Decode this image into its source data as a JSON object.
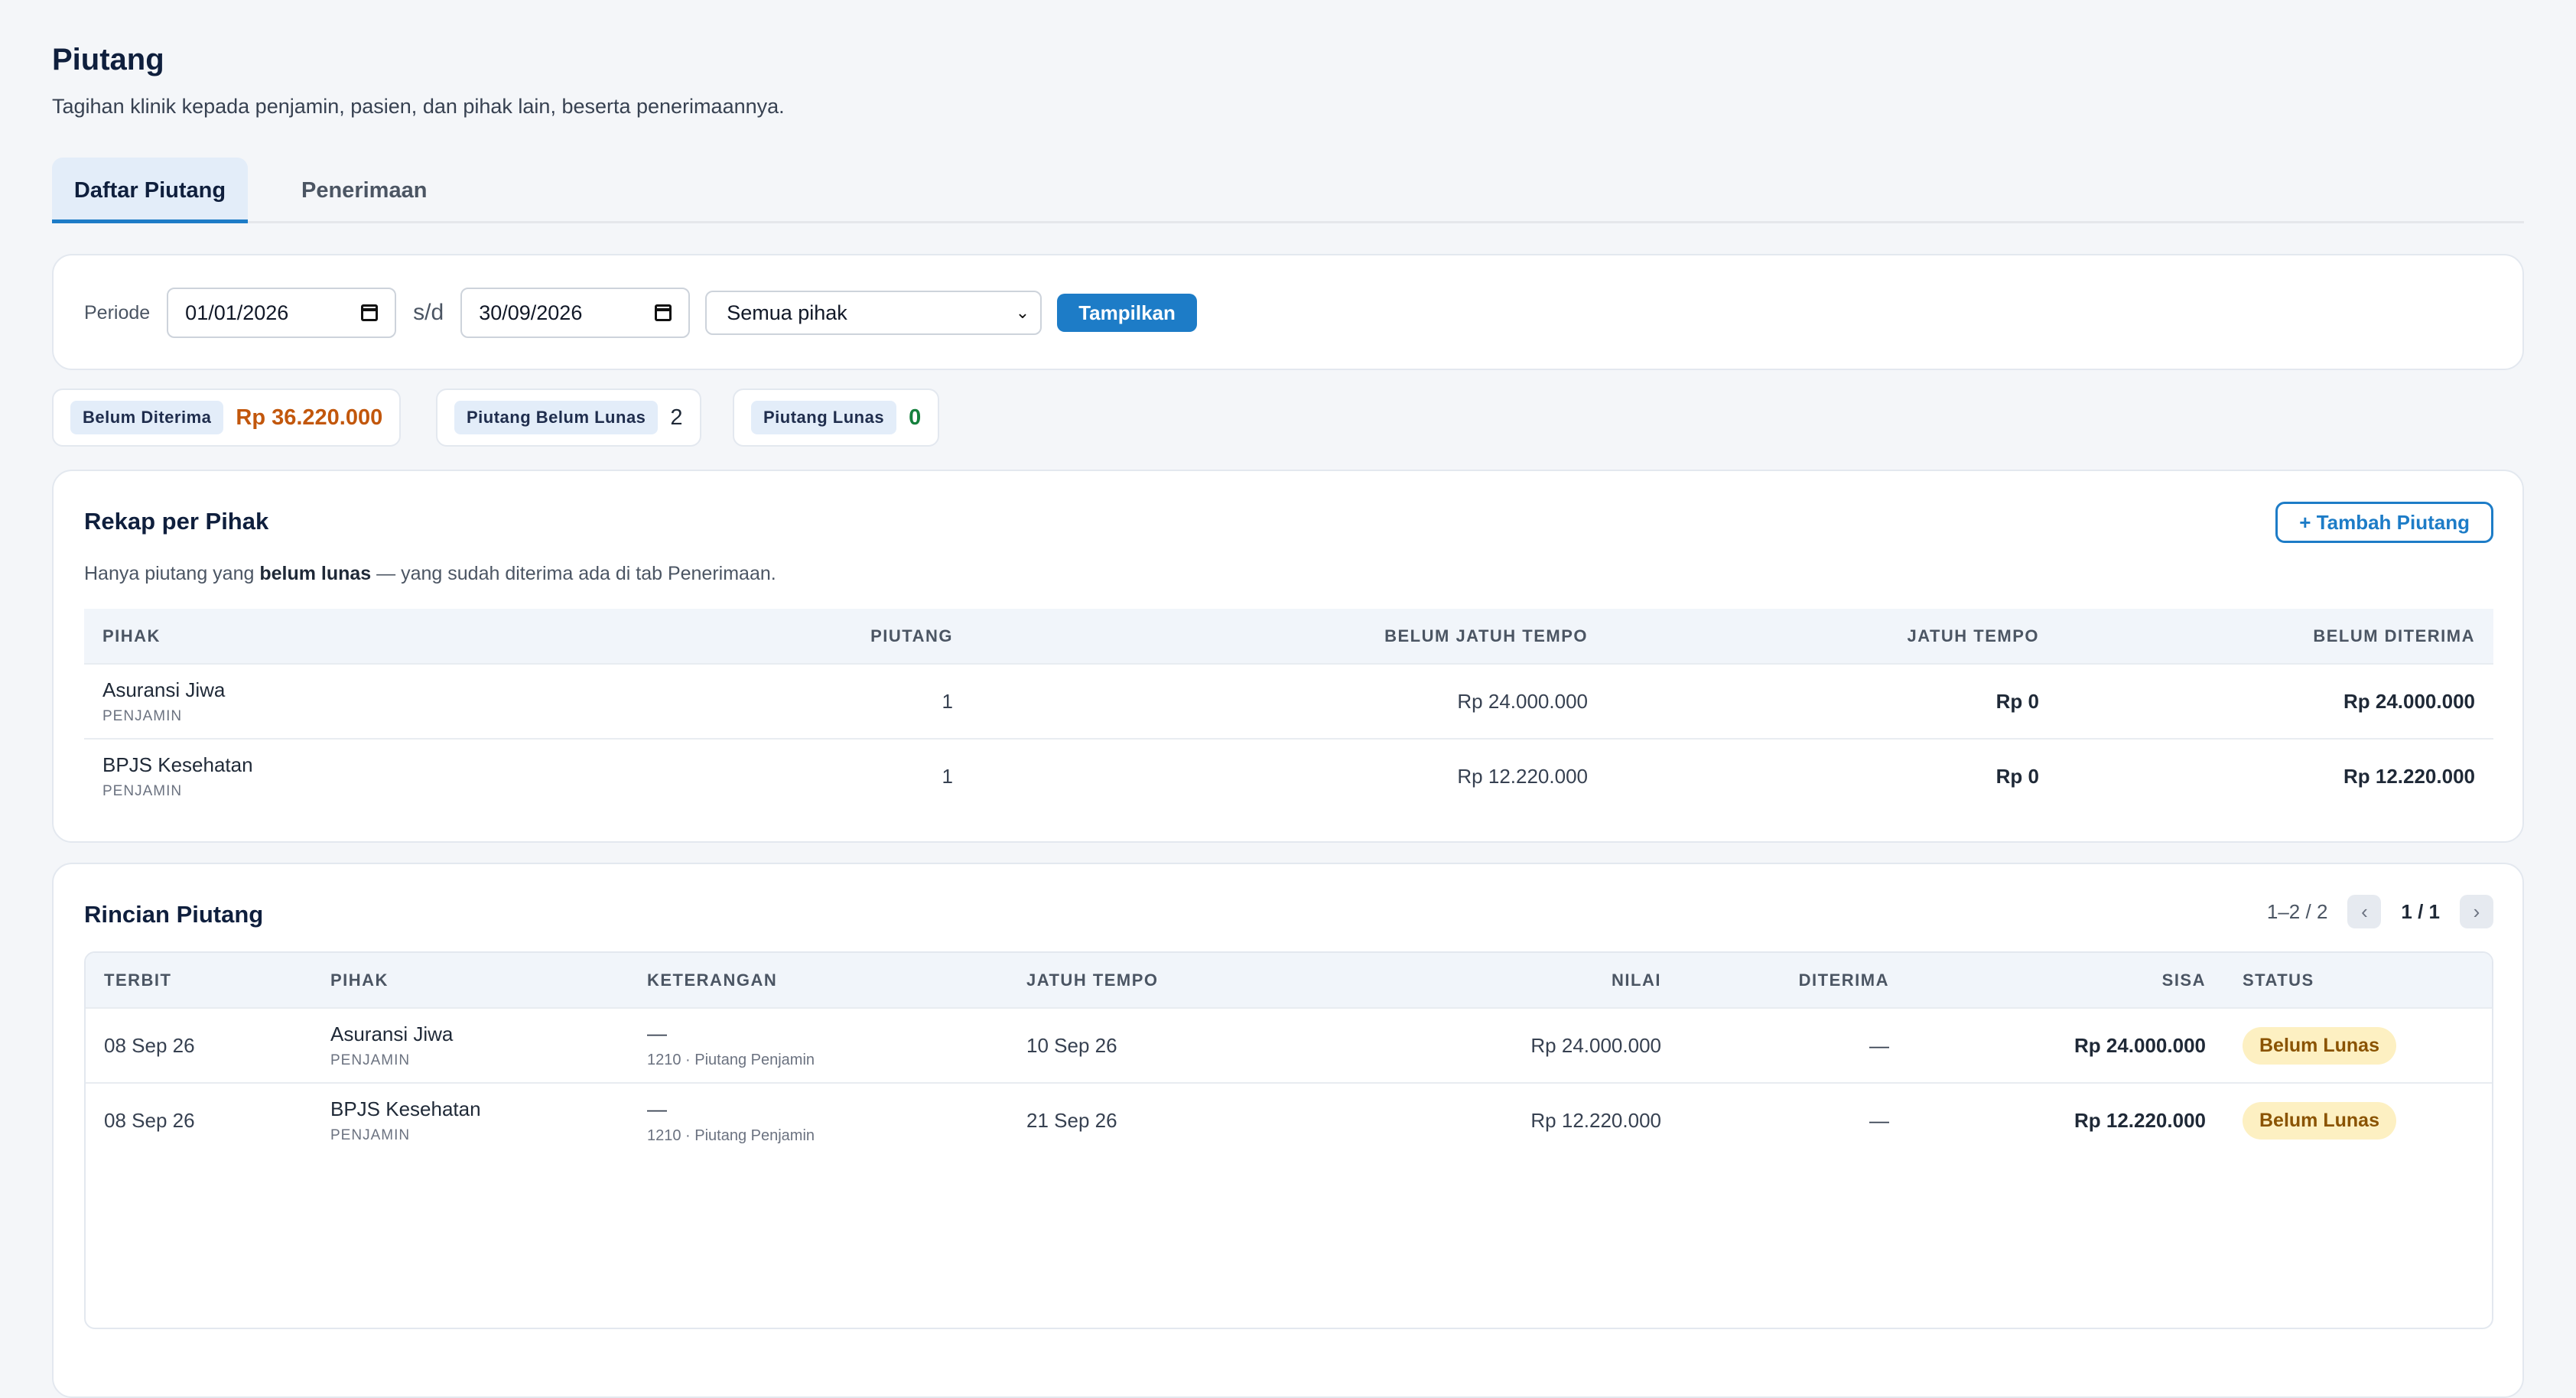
{
  "page": {
    "title": "Piutang",
    "subtitle": "Tagihan klinik kepada penjamin, pasien, dan pihak lain, beserta penerimaannya."
  },
  "tabs": [
    {
      "label": "Daftar Piutang",
      "active": true
    },
    {
      "label": "Penerimaan",
      "active": false
    }
  ],
  "filter": {
    "period_label": "Periode",
    "date_from": "01/01/2026",
    "separator": "s/d",
    "date_to": "30/09/2026",
    "party_select": "Semua pihak",
    "show_button": "Tampilkan"
  },
  "stats": [
    {
      "label": "Belum Diterima",
      "value": "Rp 36.220.000",
      "color": "#c2570c"
    },
    {
      "label": "Piutang Belum Lunas",
      "value": "2",
      "color": "#1f2937"
    },
    {
      "label": "Piutang Lunas",
      "value": "0",
      "color": "#15803d"
    }
  ],
  "rekap": {
    "title": "Rekap per Pihak",
    "add_button": "+ Tambah Piutang",
    "note_pre": "Hanya piutang yang ",
    "note_bold": "belum lunas",
    "note_post": " — yang sudah diterima ada di tab Penerimaan.",
    "columns": [
      "Pihak",
      "Piutang",
      "Belum Jatuh Tempo",
      "Jatuh Tempo",
      "Belum Diterima"
    ],
    "rows": [
      {
        "name": "Asuransi Jiwa",
        "type": "PENJAMIN",
        "count": "1",
        "not_due": "Rp 24.000.000",
        "due": "Rp 0",
        "outstanding": "Rp 24.000.000"
      },
      {
        "name": "BPJS Kesehatan",
        "type": "PENJAMIN",
        "count": "1",
        "not_due": "Rp 12.220.000",
        "due": "Rp 0",
        "outstanding": "Rp 12.220.000"
      }
    ]
  },
  "rincian": {
    "title": "Rincian Piutang",
    "pager": {
      "range": "1–2 / 2",
      "page": "1 / 1",
      "prev": "‹",
      "next": "›"
    },
    "columns": [
      "Terbit",
      "Pihak",
      "Keterangan",
      "Jatuh Tempo",
      "Nilai",
      "Diterima",
      "Sisa",
      "Status"
    ],
    "rows": [
      {
        "issued": "08 Sep 26",
        "name": "Asuransi Jiwa",
        "type": "PENJAMIN",
        "desc": "—",
        "account": "1210 · Piutang Penjamin",
        "due": "10 Sep 26",
        "value": "Rp 24.000.000",
        "received": "—",
        "remaining": "Rp 24.000.000",
        "status": "Belum Lunas"
      },
      {
        "issued": "08 Sep 26",
        "name": "BPJS Kesehatan",
        "type": "PENJAMIN",
        "desc": "—",
        "account": "1210 · Piutang Penjamin",
        "due": "21 Sep 26",
        "value": "Rp 12.220.000",
        "received": "—",
        "remaining": "Rp 12.220.000",
        "status": "Belum Lunas"
      }
    ]
  }
}
